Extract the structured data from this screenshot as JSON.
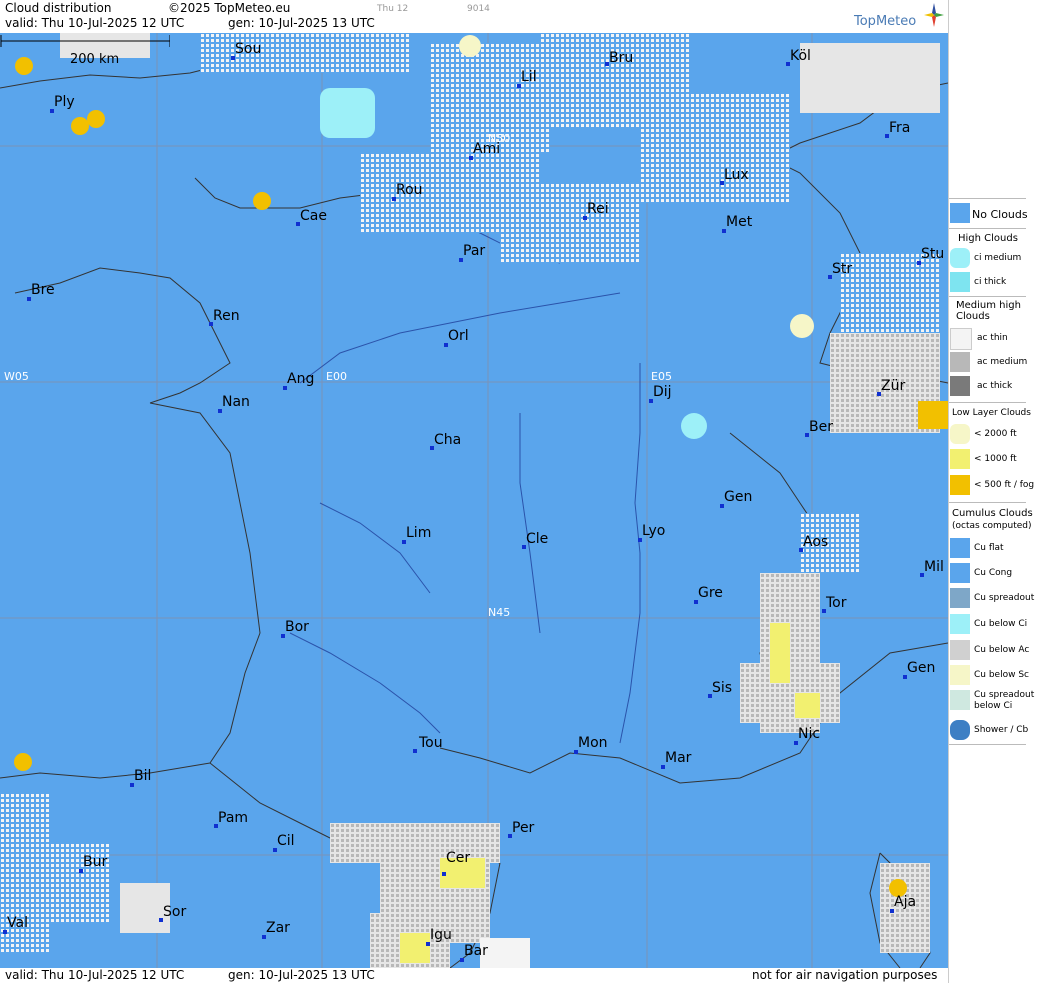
{
  "header": {
    "title": "Cloud distribution",
    "copyright": "©2025 TopMeteo.eu",
    "day_code": "Thu 12",
    "code": "9014",
    "valid": "valid:  Thu  10-Jul-2025  12 UTC",
    "gen": "gen: 10-Jul-2025 13 UTC",
    "brand": "TopMeteo"
  },
  "map": {
    "scale_label": "200 km",
    "grid_labels": [
      "N50",
      "N45",
      "W05",
      "E00",
      "E05"
    ],
    "cities": [
      "Sou",
      "Ply",
      "Lil",
      "Bru",
      "Köl",
      "Ami",
      "Fra",
      "Rou",
      "Lux",
      "Cae",
      "Rei",
      "Met",
      "Par",
      "Stu",
      "Bre",
      "Str",
      "Ren",
      "Orl",
      "Ang",
      "Nan",
      "Dij",
      "Zür",
      "Ber",
      "Cha",
      "Gen",
      "Lim",
      "Cle",
      "Lyo",
      "Aos",
      "Mil",
      "Gre",
      "Tor",
      "Bor",
      "Sis",
      "Gen",
      "Nic",
      "Tou",
      "Mon",
      "Mar",
      "Bil",
      "Pam",
      "Cil",
      "Per",
      "Bur",
      "Cer",
      "Sor",
      "Val",
      "Zar",
      "Aja",
      "Igu",
      "Bar"
    ]
  },
  "footer": {
    "valid": "valid:  Thu  10-Jul-2025  12 UTC",
    "gen": "gen: 10-Jul-2025 13 UTC",
    "disclaimer": "not for air navigation purposes"
  },
  "legend": {
    "no_clouds": "No Clouds",
    "high_title": "High Clouds",
    "ci_medium": "ci medium",
    "ci_thick": "ci thick",
    "medium_title": "Medium high Clouds",
    "ac_thin": "ac thin",
    "ac_medium": "ac medium",
    "ac_thick": "ac thick",
    "low_title": "Low Layer Clouds",
    "low_2000": "< 2000 ft",
    "low_1000": "< 1000 ft",
    "low_500": "< 500 ft / fog",
    "cumulus_title": "Cumulus Clouds",
    "cumulus_sub": "(octas computed)",
    "cu_flat": "Cu flat",
    "cu_cong": "Cu Cong",
    "cu_spread": "Cu spreadout",
    "cu_below_ci": "Cu below Ci",
    "cu_below_ac": "Cu below Ac",
    "cu_below_sc": "Cu below Sc",
    "cu_spread_ci": "Cu spreadout below Ci",
    "shower": "Shower / Cb"
  },
  "colors": {
    "sea_land": "#5aa5ec",
    "cloud_white": "#f4f4f4",
    "cloud_grey": "#bdbdbd",
    "ci_cyan": "#9df0f8",
    "low_yellow": "#f2f070",
    "fog_gold": "#f2c000",
    "pale_yellow": "#f6f6c8",
    "dot_blue": "#1030d0"
  }
}
